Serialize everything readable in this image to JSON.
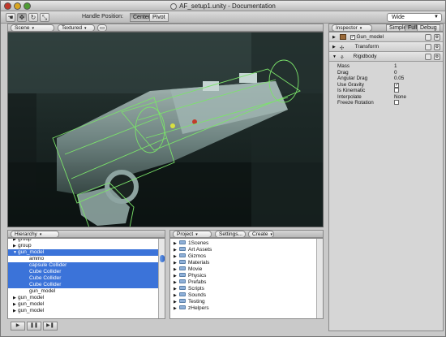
{
  "window": {
    "title": "AF_setup1.unity - Documentation"
  },
  "toolbar": {
    "tools": [
      {
        "name": "hand-tool-icon",
        "glyph": "☚"
      },
      {
        "name": "move-tool-icon",
        "glyph": "✥"
      },
      {
        "name": "rotate-tool-icon",
        "glyph": "↻"
      },
      {
        "name": "scale-tool-icon",
        "glyph": "⤡"
      }
    ],
    "handle_position_label": "Handle Position:",
    "center_label": "Center",
    "pivot_label": "Pivot",
    "layout_value": "Wide"
  },
  "scene": {
    "mode_dropdown": "Scene",
    "render_dropdown": "Textured"
  },
  "hierarchy": {
    "tab": "Hierarchy",
    "rows": [
      {
        "label": "group",
        "selected": false,
        "indent": 0,
        "expander": "▶"
      },
      {
        "label": "group",
        "selected": false,
        "indent": 0,
        "expander": "▶"
      },
      {
        "label": "gun_model",
        "selected": true,
        "indent": 0,
        "expander": "▼"
      },
      {
        "label": "ammo",
        "selected": false,
        "indent": 1,
        "expander": ""
      },
      {
        "label": "capsule Collider",
        "selected": true,
        "indent": 1,
        "expander": ""
      },
      {
        "label": "Cube Collider",
        "selected": true,
        "indent": 1,
        "expander": ""
      },
      {
        "label": "Cube Collider",
        "selected": true,
        "indent": 1,
        "expander": ""
      },
      {
        "label": "Cube Collider",
        "selected": true,
        "indent": 1,
        "expander": ""
      },
      {
        "label": "gun_model",
        "selected": false,
        "indent": 1,
        "expander": ""
      },
      {
        "label": "gun_model",
        "selected": false,
        "indent": 0,
        "expander": "▶"
      },
      {
        "label": "gun_model",
        "selected": false,
        "indent": 0,
        "expander": "▶"
      },
      {
        "label": "gun_model",
        "selected": false,
        "indent": 0,
        "expander": "▶"
      }
    ]
  },
  "project": {
    "tab": "Project",
    "settings_label": "Settings...",
    "create_label": "Create",
    "folders": [
      "1Scenes",
      "Art Assets",
      "Gizmos",
      "Materials",
      "Movie",
      "Physics",
      "Prefabs",
      "Scripts",
      "Sounds",
      "Testing",
      "zHelpers"
    ]
  },
  "inspector": {
    "tab": "Inspector",
    "mode_simple": "Simple",
    "mode_full": "Full",
    "mode_debug": "Debug",
    "object_name": "Gun_model",
    "components": [
      "Transform",
      "Rigidbody"
    ],
    "rigidbody": [
      {
        "label": "Mass",
        "value": "1"
      },
      {
        "label": "Drag",
        "value": "0"
      },
      {
        "label": "Angular Drag",
        "value": "0.05"
      },
      {
        "label": "Use Gravity",
        "value": "✓"
      },
      {
        "label": "Is Kinematic",
        "value": ""
      },
      {
        "label": "Interpolate",
        "value": "None"
      },
      {
        "label": "Freeze Rotation",
        "value": ""
      }
    ]
  },
  "playcontrols": {
    "play": "▶",
    "pause": "❚❚",
    "step": "▶❚"
  }
}
